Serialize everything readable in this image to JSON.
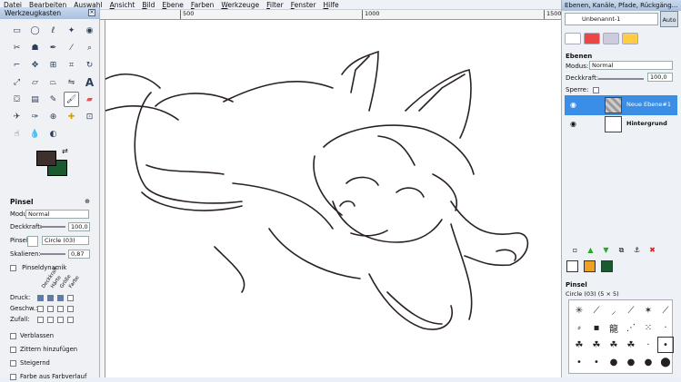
{
  "menubar": [
    "Datei",
    "Bearbeiten",
    "Auswahl",
    "Ansicht",
    "Bild",
    "Ebene",
    "Farben",
    "Werkzeuge",
    "Filter",
    "Fenster",
    "Hilfe"
  ],
  "rulers": {
    "top": [
      "500",
      "1000",
      "1500"
    ]
  },
  "toolbox": {
    "title": "Werkzeugkasten",
    "tools": [
      "rect-select",
      "ellipse-select",
      "lasso",
      "fuzzy-select",
      "color-select",
      "scissors",
      "foreground-select",
      "paths",
      "color-picker",
      "zoom",
      "measure",
      "move",
      "align",
      "crop",
      "rotate",
      "scale",
      "shear",
      "perspective",
      "flip",
      "text",
      "bucket-fill",
      "blend",
      "pencil",
      "paintbrush",
      "eraser",
      "airbrush",
      "ink",
      "clone",
      "heal",
      "perspective-clone",
      "smudge",
      "blur",
      "dodge-burn",
      "dodge",
      "convolve"
    ],
    "colors": {
      "foreground": "#3d302d",
      "background": "#1a5a2e"
    }
  },
  "tool_options": {
    "title": "Pinsel",
    "mode_label": "Modus:",
    "mode_value": "Normal",
    "opacity_label": "Deckkraft:",
    "opacity_value": "100,0",
    "brush_label": "Pinsel:",
    "brush_value": "Circle (03)",
    "scale_label": "Skalieren:",
    "scale_value": "0,87",
    "dynamics_label": "Pinseldynamik",
    "dyn_cols": [
      "Deckkraft",
      "Härte",
      "Größe",
      "Farbe"
    ],
    "dyn_rows": [
      "Druck:",
      "Geschw.:",
      "Zufall:"
    ],
    "fade_label": "Verblassen",
    "jitter_label": "Zittern hinzufügen",
    "incremental_label": "Steigernd",
    "gradient_label": "Farbe aus Farbverlauf"
  },
  "dock": {
    "title": "Ebenen, Kanäle, Pfade, Rückgäng...",
    "image_name": "Unbenannt-1",
    "auto_label": "Auto",
    "layers_title": "Ebenen",
    "mode_label": "Modus:",
    "mode_value": "Normal",
    "opacity_label": "Deckkraft:",
    "opacity_value": "100,0",
    "lock_label": "Sperre:",
    "layers": [
      {
        "name": "Neue Ebene#1",
        "selected": true
      },
      {
        "name": "Hintergrund",
        "selected": false
      }
    ],
    "brushes_title": "Pinsel",
    "brush_info": "Circle (03) (5 × 5)",
    "palette": [
      "#3d302d",
      "#f0a020",
      "#1a5a2e"
    ]
  }
}
